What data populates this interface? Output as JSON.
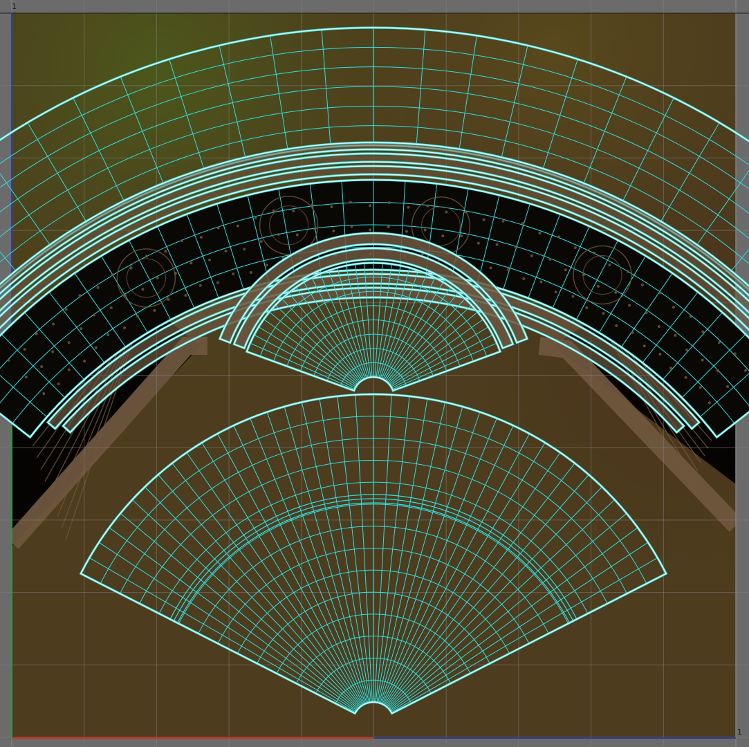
{
  "viewport": {
    "label_v_max": "1",
    "label_u_max": "1"
  },
  "colors": {
    "background": "#6b6b6b",
    "texture_base": "#4d3c1d",
    "texture_dark": "#050402",
    "texture_trim": "#6f563e",
    "grid_line": "#808080",
    "uv_edge": "#2ee0e6",
    "uv_boundary": "#f2f2e6",
    "u_axis": "#c0392b",
    "v_axis": "#2f3db0",
    "u_axis_secondary": "#2c3a9a",
    "v_axis_secondary": "#2c9a3a"
  }
}
